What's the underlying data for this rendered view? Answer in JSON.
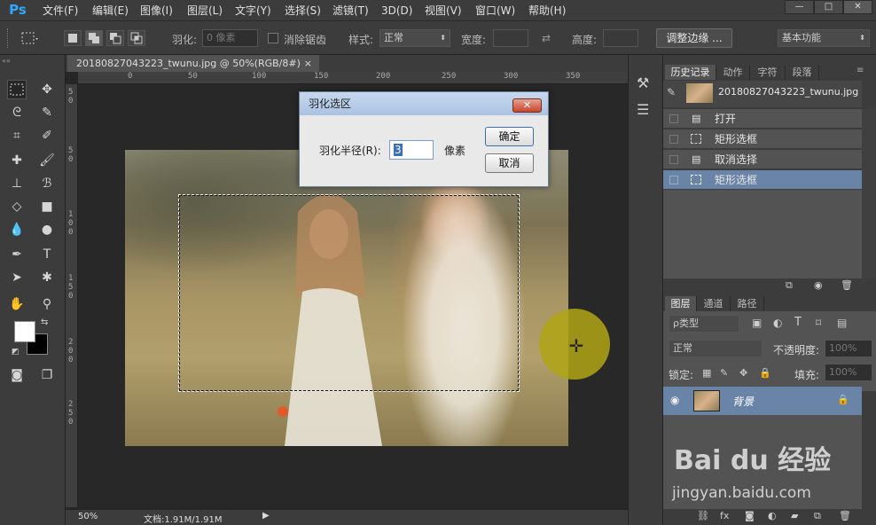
{
  "app": {
    "logo": "Ps"
  },
  "menu": [
    "文件(F)",
    "编辑(E)",
    "图像(I)",
    "图层(L)",
    "文字(Y)",
    "选择(S)",
    "滤镜(T)",
    "3D(D)",
    "视图(V)",
    "窗口(W)",
    "帮助(H)"
  ],
  "window_controls": {
    "minimize": "—",
    "maximize": "□",
    "close": "✕"
  },
  "options": {
    "feather_label": "羽化:",
    "feather_value": "0 像素",
    "antialias_label": "消除锯齿",
    "style_label": "样式:",
    "style_value": "正常",
    "width_label": "宽度:",
    "height_label": "高度:",
    "refine_edge": "调整边缘 ...",
    "workspace": "基本功能"
  },
  "document": {
    "tab_title": "20180827043223_twunu.jpg @ 50%(RGB/8#)",
    "tab_close": "×",
    "ruler_h": [
      "0",
      "50",
      "100",
      "150",
      "200",
      "250",
      "300",
      "350"
    ],
    "ruler_v": [
      "5",
      "0",
      "5",
      "0",
      "1",
      "0",
      "0",
      "1",
      "5",
      "0",
      "2",
      "0",
      "0",
      "2",
      "5",
      "0"
    ],
    "zoom": "50%",
    "doc_info": "文档:1.91M/1.91M"
  },
  "history_panel": {
    "tabs": [
      "历史记录",
      "动作",
      "字符",
      "段落"
    ],
    "snapshot": "20180827043223_twunu.jpg",
    "items": [
      "打开",
      "矩形选框",
      "取消选择",
      "矩形选框"
    ]
  },
  "layers_panel": {
    "tabs": [
      "图层",
      "通道",
      "路径"
    ],
    "kind_filter": "ρ类型",
    "blend_mode": "正常",
    "opacity_label": "不透明度:",
    "opacity_value": "100%",
    "lock_label": "锁定:",
    "fill_label": "填充:",
    "fill_value": "100%",
    "layer_name": "背景"
  },
  "dialog": {
    "title": "羽化选区",
    "close": "✕",
    "radius_label": "羽化半径(R):",
    "radius_value": "3",
    "unit": "像素",
    "ok": "确定",
    "cancel": "取消"
  },
  "watermark": {
    "logo": "Bai du 经验",
    "url": "jingyan.baidu.com"
  }
}
